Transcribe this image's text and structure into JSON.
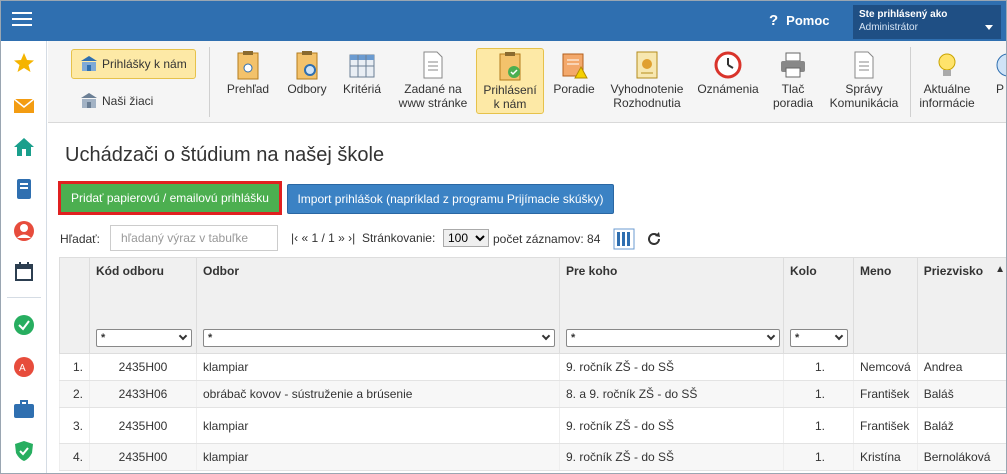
{
  "topbar": {
    "help_label": "Pomoc",
    "user_line1": "Ste prihlásený ako",
    "user_line2": "Administrátor"
  },
  "toolbar": {
    "left": [
      {
        "label": "Prihlášky k nám"
      },
      {
        "label": "Naši žiaci"
      }
    ],
    "items": [
      {
        "label": "Prehľad"
      },
      {
        "label": "Odbory"
      },
      {
        "label": "Kritériá"
      },
      {
        "label1": "Zadané na",
        "label2": "www stránke"
      },
      {
        "label1": "Prihlásení",
        "label2": "k nám"
      },
      {
        "label": "Poradie"
      },
      {
        "label1": "Vyhodnotenie",
        "label2": "Rozhodnutia"
      },
      {
        "label": "Oznámenia"
      },
      {
        "label1": "Tlač",
        "label2": "poradia"
      },
      {
        "label1": "Správy",
        "label2": "Komunikácia"
      },
      {
        "label1": "Aktuálne",
        "label2": "informácie"
      },
      {
        "label": "P"
      }
    ]
  },
  "page": {
    "title": "Uchádzači o štúdium na našej škole",
    "add_button": "Pridať papierovú / emailovú prihlášku",
    "import_button": "Import prihlášok (napríklad z programu Prijímacie skúšky)",
    "search_label": "Hľadať:",
    "search_placeholder": "hľadaný výraz v tabuľke",
    "pager_text": "|‹ « 1 / 1 » ›|",
    "perpage_label": "Stránkovanie:",
    "perpage_value": "100",
    "count_text": "počet záznamov: 84"
  },
  "table": {
    "headers": [
      "",
      "Kód odboru",
      "Odbor",
      "Pre koho",
      "Kolo",
      "Meno",
      "Priezvisko"
    ],
    "filter_value": "*",
    "rows": [
      [
        "1.",
        "2435H00",
        "klampiar",
        "9. ročník ZŠ - do SŠ",
        "1.",
        "Nemcová",
        "Andrea"
      ],
      [
        "2.",
        "2433H06",
        "obrábač kovov - sústruženie a brúsenie",
        "8. a 9. ročník ZŠ - do SŠ",
        "1.",
        "František",
        "Baláš"
      ],
      [
        "3.",
        "2435H00",
        "klampiar",
        "9. ročník ZŠ - do SŠ",
        "1.",
        "František",
        "Baláž"
      ],
      [
        "4.",
        "2435H00",
        "klampiar",
        "9. ročník ZŠ - do SŠ",
        "1.",
        "Kristína",
        "Bernoláková"
      ]
    ]
  },
  "colors": {
    "topbar": "#2f6fb0",
    "add_button": "#4caf50",
    "import_button": "#3b82c4",
    "highlight": "#fde9a6"
  }
}
